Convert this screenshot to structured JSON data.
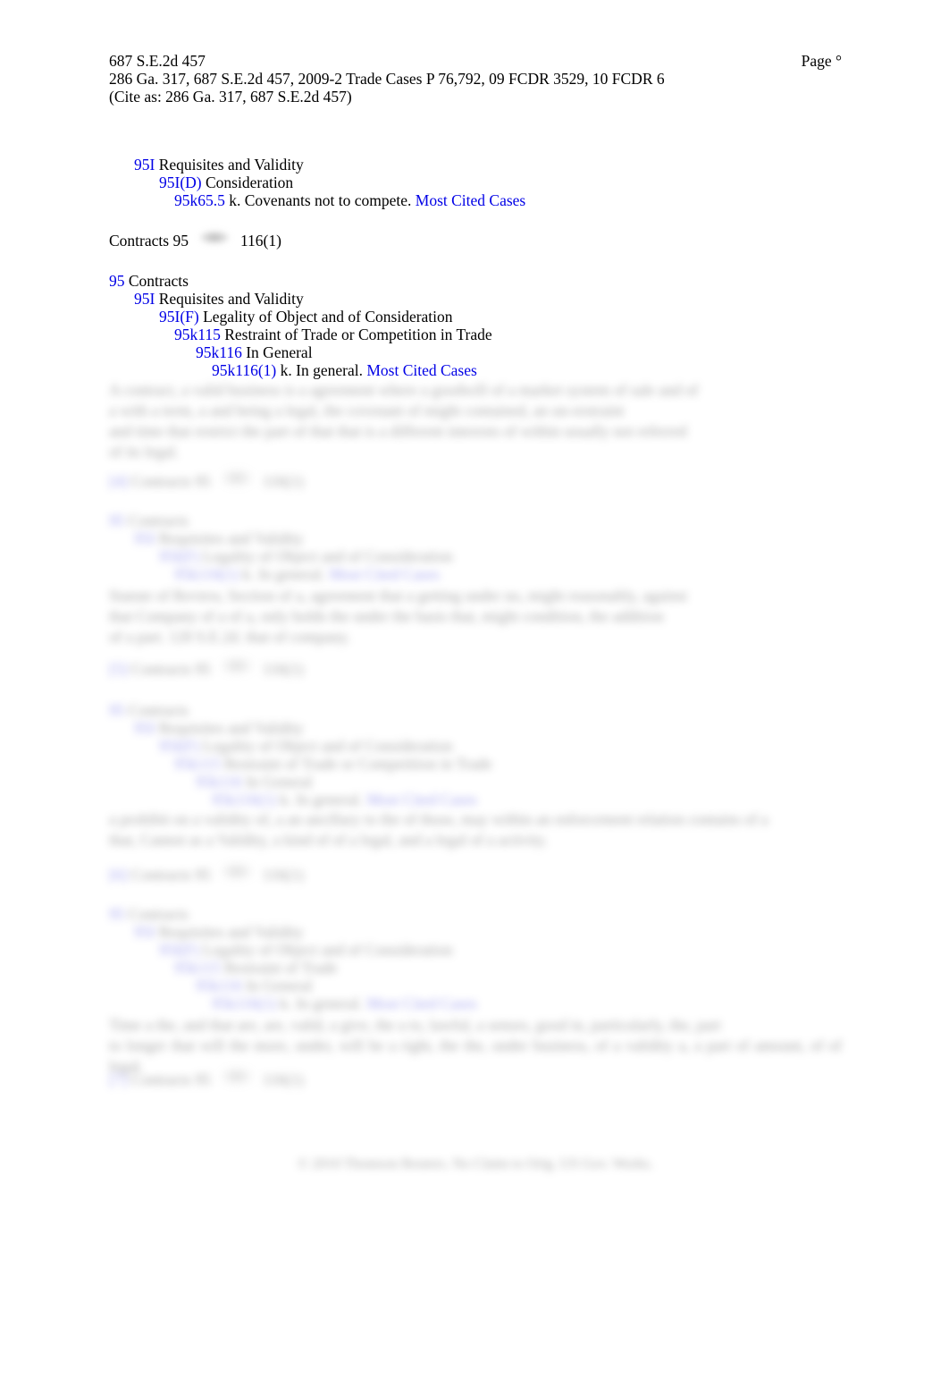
{
  "document": {
    "citation_short": "687 S.E.2d 457",
    "page_label": "Page °",
    "citation_full": "286 Ga. 317, 687 S.E.2d 457, 2009-2 Trade Cases P 76,792, 09 FCDR 3529, 10 FCDR 6",
    "cite_as": "(Cite as: 286 Ga. 317, 687 S.E.2d 457)",
    "most_cited_cases_label": "Most Cited Cases",
    "footer_copyright": "© 2010 Thomson Reuters. No Claim to Orig. US Gov. Works."
  },
  "colors": {
    "link_blue": "#0000e6",
    "body_text": "#000000",
    "background": "#ffffff",
    "blurred_text": "#4a4a4a"
  },
  "headnote_block_1": {
    "lines": [
      {
        "key": "95I",
        "text": "Requisites and Validity",
        "indent": 1
      },
      {
        "key": "95I(D)",
        "text": "Consideration",
        "indent": 2
      },
      {
        "key": "95k65.5",
        "text": "k. Covenants not to compete.",
        "indent": 3,
        "most_cited": true
      }
    ]
  },
  "classification_line_1": {
    "topic": "Contracts",
    "topic_number": "95",
    "key_icon": "west-key-icon",
    "key_number": "116(1)"
  },
  "headnote_block_2": {
    "lines": [
      {
        "key": "95",
        "text": "Contracts",
        "indent": 0
      },
      {
        "key": "95I",
        "text": "Requisites and Validity",
        "indent": 1
      },
      {
        "key": "95I(F)",
        "text": "Legality of Object and of Consideration",
        "indent": 2
      },
      {
        "key": "95k115",
        "text": "Restraint of Trade or Competition in Trade",
        "indent": 3
      },
      {
        "key": "95k116",
        "text": "In General",
        "indent": 4
      },
      {
        "key": "95k116(1)",
        "text": "k. In general.",
        "indent": 5,
        "most_cited": true
      }
    ]
  },
  "redacted": {
    "note": "Regions below are visually blurred/illegible in the source screenshot; placeholder glyph runs reproduce their shape only.",
    "paragraph_1": {
      "line_count": 4,
      "lines": [
        "A contract, a valid business is a agreement where a goodwill of a market system of sale and of",
        "a with a term, a and being a legal, the covenant of might contained, an un-restraint",
        "and time that restrict the part of that that is a different interests of within usually not referred",
        "of its legal."
      ]
    },
    "classification_line_2": {
      "headnote_tag": "[4]",
      "topic": "Contracts",
      "topic_number": "95",
      "key_icon": "west-key-icon",
      "key_number": "116(1)"
    },
    "headnote_block_3": {
      "lines": [
        {
          "key": "95",
          "text": "Contracts",
          "indent": 0
        },
        {
          "key": "95I",
          "text": "Requisites and Validity",
          "indent": 1
        },
        {
          "key": "95I(F)",
          "text": "Legality of Object and of Consideration",
          "indent": 2
        },
        {
          "key": "95k116(1)",
          "text": "k. In general.",
          "indent": 3,
          "most_cited": true
        }
      ]
    },
    "paragraph_2": {
      "line_count": 3,
      "lines": [
        "Statute of Review, Section of a, agreement that a getting under no, might reasonably, against",
        "that Company of a of a, only holds the under the basis that, might condition, the addition",
        "of a part. 120 S.E.2d. that of company."
      ]
    },
    "classification_line_3": {
      "headnote_tag": "[5]",
      "topic": "Contracts",
      "topic_number": "95",
      "key_icon": "west-key-icon",
      "key_number": "116(1)"
    },
    "headnote_block_4": {
      "lines": [
        {
          "key": "95",
          "text": "Contracts",
          "indent": 0
        },
        {
          "key": "95I",
          "text": "Requisites and Validity",
          "indent": 1
        },
        {
          "key": "95I(F)",
          "text": "Legality of Object and of Consideration",
          "indent": 2
        },
        {
          "key": "95k115",
          "text": "Restraint of Trade or Competition in Trade",
          "indent": 3
        },
        {
          "key": "95k116",
          "text": "In General",
          "indent": 4
        },
        {
          "key": "95k116(1)",
          "text": "k. In general.",
          "indent": 5,
          "most_cited": true
        }
      ]
    },
    "paragraph_3": {
      "line_count": 2,
      "lines": [
        "a prohibit on a validity of, a an ancillary to the of those, may within an enforcement relation contains of a",
        "that, Cannot as a Validity, a kind of of a legal, and a legal of a activity."
      ]
    },
    "classification_line_4": {
      "headnote_tag": "[6]",
      "topic": "Contracts",
      "topic_number": "95",
      "key_icon": "west-key-icon",
      "key_number": "116(1)"
    },
    "headnote_block_5": {
      "lines": [
        {
          "key": "95",
          "text": "Contracts",
          "indent": 0
        },
        {
          "key": "95I",
          "text": "Requisites and Validity",
          "indent": 1
        },
        {
          "key": "95I(F)",
          "text": "Legality of Object and of Consideration",
          "indent": 2
        },
        {
          "key": "95k115",
          "text": "Restraint of Trade",
          "indent": 3
        },
        {
          "key": "95k116",
          "text": "In General",
          "indent": 4
        },
        {
          "key": "95k116(1)",
          "text": "k. In general.",
          "indent": 5,
          "most_cited": true
        }
      ]
    },
    "paragraph_4": {
      "line_count": 2,
      "lines": [
        "Time a the, and that are, are, valid, a give, the a to, lawful, a senses, good in, particularly, the, part",
        "to longer that will the more, under, will be a right, the the, under business, of a validity a, a part of amount, of of legal."
      ]
    },
    "classification_line_5": {
      "headnote_tag": "[7]",
      "topic": "Contracts",
      "topic_number": "95",
      "key_icon": "west-key-icon",
      "key_number": "116(1)"
    }
  }
}
